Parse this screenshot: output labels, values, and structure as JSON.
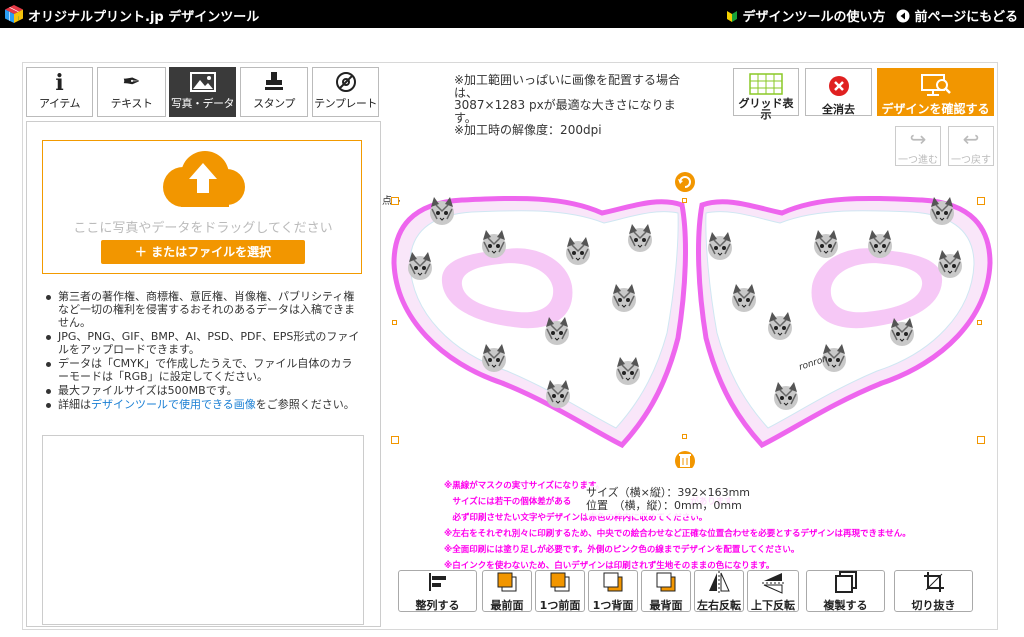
{
  "header": {
    "title": "オリジナルプリント.jp デザインツール",
    "help_link": "デザインツールの使い方",
    "back_link": "前ページにもどる"
  },
  "tabs": [
    {
      "label": "アイテム",
      "icon": "info-icon"
    },
    {
      "label": "テキスト",
      "icon": "pen-icon"
    },
    {
      "label": "写真・データ",
      "icon": "image-icon",
      "active": true
    },
    {
      "label": "スタンプ",
      "icon": "stamp-icon"
    },
    {
      "label": "テンプレート",
      "icon": "template-icon"
    }
  ],
  "upload": {
    "drop_text": "ここに写真やデータをドラッグしてください",
    "file_button": "＋ またはファイルを選択"
  },
  "notes": {
    "n1": "第三者の著作権、商標権、意匠権、肖像権、パブリシティ権など一切の権利を侵害するおそれのあるデータは入稿できません。",
    "n2": "JPG、PNG、GIF、BMP、AI、PSD、PDF、EPS形式のファイルをアップロードできます。",
    "n3": "データは「CMYK」で作成したうえで、ファイル自体のカラーモードは「RGB」に設定してください。",
    "n4": "最大ファイルサイズは500MBです。",
    "n5_pre": "詳細は",
    "n5_link": "デザインツールで使用できる画像",
    "n5_post": "をご参照ください。"
  },
  "info": {
    "line1": "※加工範囲いっぱいに画像を配置する場合は、",
    "line2": "3087×1283 pxが最適な大きさになります。",
    "line3": "※加工時の解像度：200dpi"
  },
  "toolbar": {
    "grid": "グリッド表示",
    "clear": "全消去",
    "confirm": "デザインを確認する",
    "redo": "一つ進む",
    "undo": "一つ戻す"
  },
  "canvas": {
    "mask_text": "ronron",
    "side_label": "点→"
  },
  "size_info": {
    "size": "サイズ（横×縦）：392×163mm",
    "position": "位置　（横，縦）：0mm，0mm"
  },
  "warnings": [
    "※黒線がマスクの実寸サイズになります。",
    "　サイズには若干の個体差がある　　　　　　　　　　　　　　があります。",
    "　必ず印刷させたい文字やデザインは赤色の枠内に収めてください。",
    "※左右をそれぞれ別々に印刷するため、中央での絵合わせなど正確な位置合わせを必要とするデザインは再現できません。",
    "※全面印刷には塗り足しが必要です。外側のピンク色の線までデザインを配置してください。",
    "※白インクを使わないため、白いデザインは印刷されず生地そのままの色になります。"
  ],
  "bottom_buttons": {
    "align": "整列する",
    "front": "最前面",
    "forward": "1つ前面",
    "backward": "1つ背面",
    "back": "最背面",
    "flip_h": "左右反転",
    "flip_v": "上下反転",
    "duplicate": "複製する",
    "crop": "切り抜き"
  },
  "colors": {
    "accent": "#f29600",
    "header": "#000000",
    "mask_outline": "#ee66ee",
    "warning_text": "#ff00ee",
    "clear_icon": "#e02020",
    "grid_icon": "#8ac926",
    "link": "#1a7fd4"
  }
}
